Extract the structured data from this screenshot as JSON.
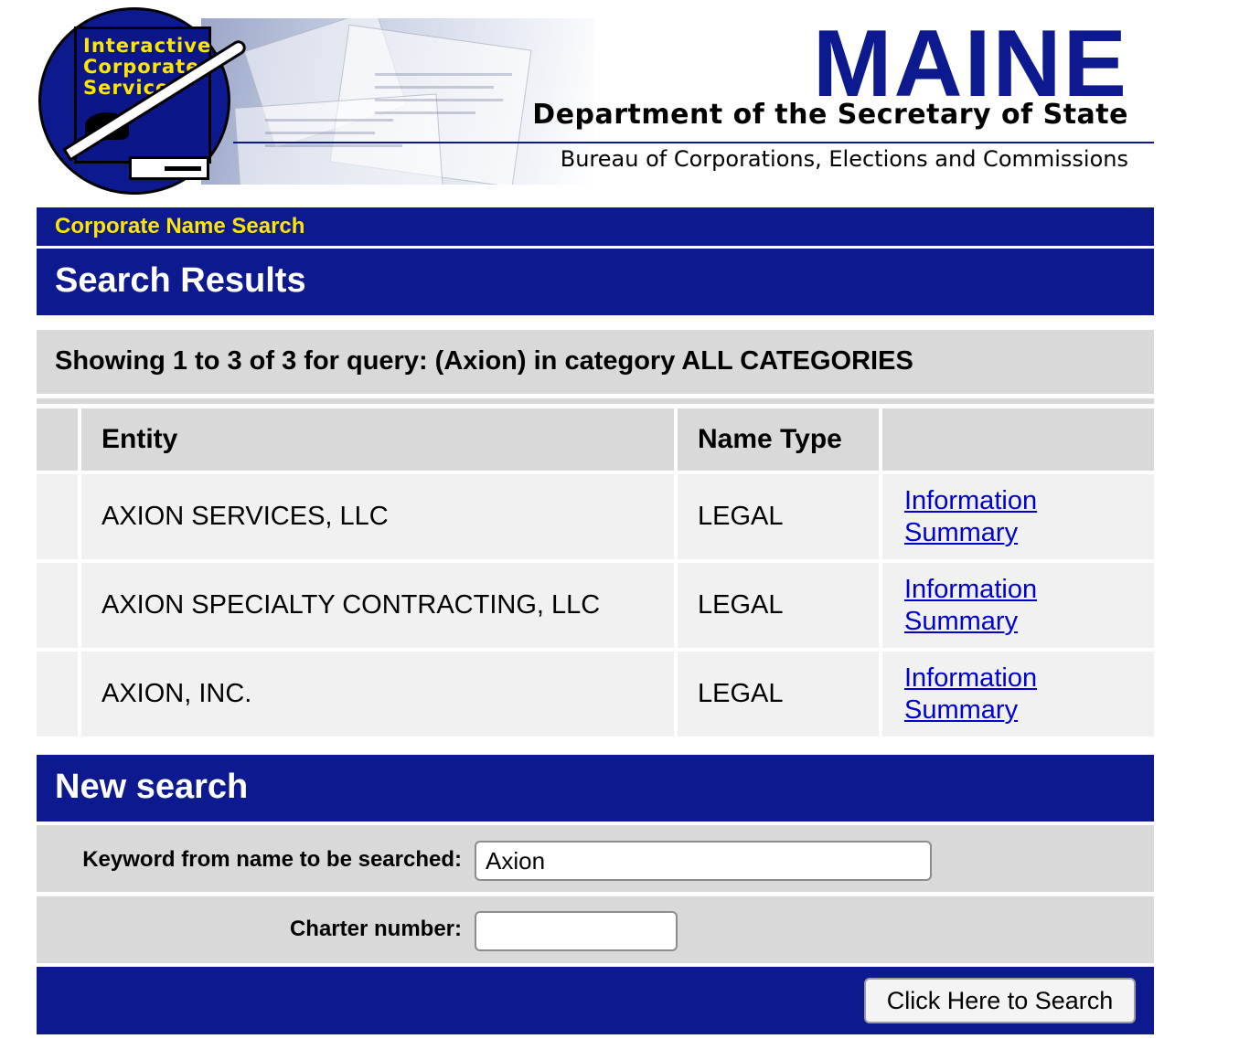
{
  "header": {
    "seal_lines": [
      "Interactive",
      "Corporate",
      "Services"
    ],
    "state": "MAINE",
    "department": "Department of the Secretary of State",
    "bureau": "Bureau of Corporations, Elections and Commissions"
  },
  "breadcrumb": "Corporate Name Search",
  "results": {
    "heading": "Search Results",
    "summary": "Showing 1 to 3 of 3 for query: (Axion) in category ALL CATEGORIES",
    "columns": [
      "",
      "Entity",
      "Name Type",
      ""
    ],
    "rows": [
      {
        "entity": "AXION SERVICES, LLC",
        "name_type": "LEGAL",
        "link": "Information Summary"
      },
      {
        "entity": "AXION SPECIALTY CONTRACTING, LLC",
        "name_type": "LEGAL",
        "link": "Information Summary"
      },
      {
        "entity": "AXION, INC.",
        "name_type": "LEGAL",
        "link": "Information Summary"
      }
    ]
  },
  "new_search": {
    "heading": "New search",
    "keyword_label": "Keyword from name to be searched:",
    "keyword_value": "Axion",
    "charter_label": "Charter number:",
    "charter_value": "",
    "button_label": "Click Here to Search"
  },
  "colors": {
    "brand_blue": "#0d1a8f",
    "accent_yellow": "#ffe600",
    "link_blue": "#0000cc",
    "row_gray": "#d9d9d9"
  }
}
